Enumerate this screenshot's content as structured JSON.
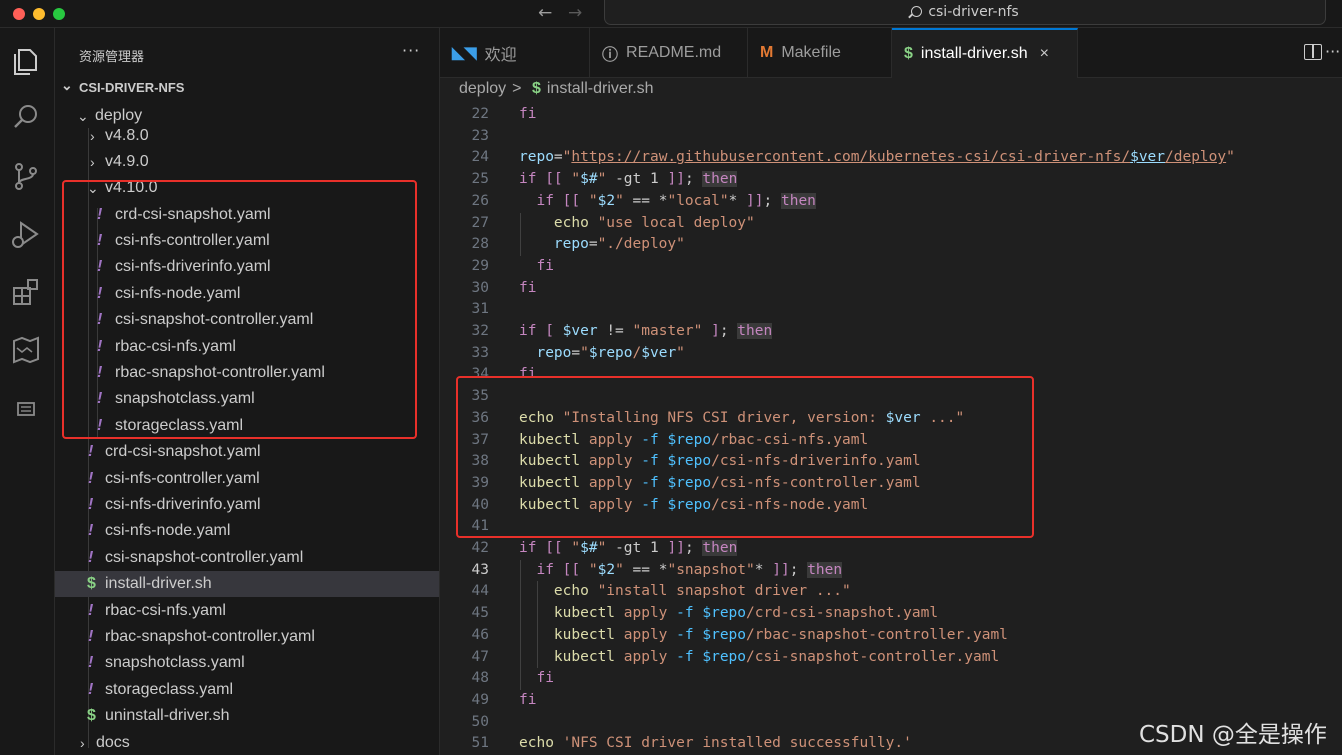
{
  "window": {
    "search_text": "csi-driver-nfs"
  },
  "sidebar": {
    "title": "资源管理器",
    "more": "···",
    "section": "CSI-DRIVER-NFS",
    "tree": [
      {
        "label": "deploy",
        "type": "folder",
        "expanded": true
      },
      {
        "label": "v4.8.0",
        "type": "folder",
        "expanded": false
      },
      {
        "label": "v4.9.0",
        "type": "folder",
        "expanded": false
      },
      {
        "label": "v4.10.0",
        "type": "folder",
        "expanded": true
      },
      {
        "label": "crd-csi-snapshot.yaml",
        "type": "yaml"
      },
      {
        "label": "csi-nfs-controller.yaml",
        "type": "yaml"
      },
      {
        "label": "csi-nfs-driverinfo.yaml",
        "type": "yaml"
      },
      {
        "label": "csi-nfs-node.yaml",
        "type": "yaml"
      },
      {
        "label": "csi-snapshot-controller.yaml",
        "type": "yaml"
      },
      {
        "label": "rbac-csi-nfs.yaml",
        "type": "yaml"
      },
      {
        "label": "rbac-snapshot-controller.yaml",
        "type": "yaml"
      },
      {
        "label": "snapshotclass.yaml",
        "type": "yaml"
      },
      {
        "label": "storageclass.yaml",
        "type": "yaml"
      },
      {
        "label": "crd-csi-snapshot.yaml",
        "type": "yaml"
      },
      {
        "label": "csi-nfs-controller.yaml",
        "type": "yaml"
      },
      {
        "label": "csi-nfs-driverinfo.yaml",
        "type": "yaml"
      },
      {
        "label": "csi-nfs-node.yaml",
        "type": "yaml"
      },
      {
        "label": "csi-snapshot-controller.yaml",
        "type": "yaml"
      },
      {
        "label": "install-driver.sh",
        "type": "sh",
        "active": true
      },
      {
        "label": "rbac-csi-nfs.yaml",
        "type": "yaml"
      },
      {
        "label": "rbac-snapshot-controller.yaml",
        "type": "yaml"
      },
      {
        "label": "snapshotclass.yaml",
        "type": "yaml"
      },
      {
        "label": "storageclass.yaml",
        "type": "yaml"
      },
      {
        "label": "uninstall-driver.sh",
        "type": "sh"
      },
      {
        "label": "docs",
        "type": "folder",
        "expanded": false
      }
    ]
  },
  "tabs": [
    {
      "label": "欢迎",
      "icon": "vscode-icon"
    },
    {
      "label": "README.md",
      "icon": "info-icon"
    },
    {
      "label": "Makefile",
      "icon": "makefile-icon"
    },
    {
      "label": "install-driver.sh",
      "icon": "shell-icon",
      "active": true,
      "close": "×"
    }
  ],
  "breadcrumb": {
    "folder": "deploy",
    "separator": ">",
    "file_icon": "$",
    "file": "install-driver.sh"
  },
  "icons": {
    "yaml": "!",
    "sh": "$",
    "chev_open": "⌄",
    "chev_closed": "›"
  },
  "editor": {
    "current_line": 43,
    "lines": [
      {
        "n": "22",
        "html": "<span class=\"k\">fi</span>"
      },
      {
        "n": "23",
        "html": ""
      },
      {
        "n": "24",
        "html": "<span class=\"v\">repo</span><span class=\"o\">=</span><span class=\"s\">\"</span><span class=\"u\">https://raw.githubusercontent.com/kubernetes-csi/csi-driver-nfs/</span><span class=\"v\" style=\"text-decoration:underline\">$ver</span><span class=\"u\">/deploy</span><span class=\"s\">\"</span>"
      },
      {
        "n": "25",
        "html": "<span class=\"k\">if</span> <span class=\"k\">[[</span> <span class=\"s\">\"</span><span class=\"v\">$#</span><span class=\"s\">\"</span> <span class=\"o\">-gt</span> 1 <span class=\"k\">]]</span>; <span class=\"kw\">then</span>"
      },
      {
        "n": "26",
        "html": "  <span class=\"k\">if</span> <span class=\"k\">[[</span> <span class=\"s\">\"</span><span class=\"v\">$2</span><span class=\"s\">\"</span> == <span class=\"o\">*</span><span class=\"s\">\"local\"</span><span class=\"o\">*</span> <span class=\"k\">]]</span>; <span class=\"kw\">then</span>"
      },
      {
        "n": "27",
        "html": "    <span class=\"f\">echo</span> <span class=\"s\">\"use local deploy\"</span>"
      },
      {
        "n": "28",
        "html": "    <span class=\"v\">repo</span><span class=\"o\">=</span><span class=\"s\">\"./deploy\"</span>"
      },
      {
        "n": "29",
        "html": "  <span class=\"k\">fi</span>"
      },
      {
        "n": "30",
        "html": "<span class=\"k\">fi</span>"
      },
      {
        "n": "31",
        "html": ""
      },
      {
        "n": "32",
        "html": "<span class=\"k\">if</span> <span class=\"k\">[</span> <span class=\"v\">$ver</span> != <span class=\"s\">\"master\"</span> <span class=\"k\">]</span>; <span class=\"kw\">then</span>"
      },
      {
        "n": "33",
        "html": "  <span class=\"v\">repo</span><span class=\"o\">=</span><span class=\"s\">\"</span><span class=\"v\">$repo</span><span class=\"s\">/</span><span class=\"v\">$ver</span><span class=\"s\">\"</span>"
      },
      {
        "n": "34",
        "html": "<span class=\"k\">fi</span>"
      },
      {
        "n": "35",
        "html": ""
      },
      {
        "n": "36",
        "html": "<span class=\"f\">echo</span> <span class=\"s\">\"Installing NFS CSI driver, version: </span><span class=\"v\">$ver</span><span class=\"s\"> ...\"</span>"
      },
      {
        "n": "37",
        "html": "<span class=\"f\">kubectl</span> <span class=\"s\">apply</span> <span class=\"sc\">-f</span> <span class=\"sc\">$repo</span><span class=\"s\">/rbac-csi-nfs.yaml</span>"
      },
      {
        "n": "38",
        "html": "<span class=\"f\">kubectl</span> <span class=\"s\">apply</span> <span class=\"sc\">-f</span> <span class=\"sc\">$repo</span><span class=\"s\">/csi-nfs-driverinfo.yaml</span>"
      },
      {
        "n": "39",
        "html": "<span class=\"f\">kubectl</span> <span class=\"s\">apply</span> <span class=\"sc\">-f</span> <span class=\"sc\">$repo</span><span class=\"s\">/csi-nfs-controller.yaml</span>"
      },
      {
        "n": "40",
        "html": "<span class=\"f\">kubectl</span> <span class=\"s\">apply</span> <span class=\"sc\">-f</span> <span class=\"sc\">$repo</span><span class=\"s\">/csi-nfs-node.yaml</span>"
      },
      {
        "n": "41",
        "html": ""
      },
      {
        "n": "42",
        "html": "<span class=\"k\">if</span> <span class=\"k\">[[</span> <span class=\"s\">\"</span><span class=\"v\">$#</span><span class=\"s\">\"</span> <span class=\"o\">-gt</span> 1 <span class=\"k\">]]</span>; <span class=\"kw\">then</span>"
      },
      {
        "n": "43",
        "html": "  <span class=\"k\">if</span> <span class=\"k\">[[</span> <span class=\"s\">\"</span><span class=\"v\">$2</span><span class=\"s\">\"</span> == <span class=\"o\">*</span><span class=\"s\">\"snapshot\"</span><span class=\"o\">*</span> <span class=\"k\">]]</span>; <span class=\"kw\">then</span>"
      },
      {
        "n": "44",
        "html": "    <span class=\"f\">echo</span> <span class=\"s\">\"install snapshot driver ...\"</span>"
      },
      {
        "n": "45",
        "html": "    <span class=\"f\">kubectl</span> <span class=\"s\">apply</span> <span class=\"sc\">-f</span> <span class=\"sc\">$repo</span><span class=\"s\">/crd-csi-snapshot.yaml</span>"
      },
      {
        "n": "46",
        "html": "    <span class=\"f\">kubectl</span> <span class=\"s\">apply</span> <span class=\"sc\">-f</span> <span class=\"sc\">$repo</span><span class=\"s\">/rbac-snapshot-controller.yaml</span>"
      },
      {
        "n": "47",
        "html": "    <span class=\"f\">kubectl</span> <span class=\"s\">apply</span> <span class=\"sc\">-f</span> <span class=\"sc\">$repo</span><span class=\"s\">/csi-snapshot-controller.yaml</span>"
      },
      {
        "n": "48",
        "html": "  <span class=\"k\">fi</span>"
      },
      {
        "n": "49",
        "html": "<span class=\"k\">fi</span>"
      },
      {
        "n": "50",
        "html": ""
      },
      {
        "n": "51",
        "html": "<span class=\"f\">echo</span> <span class=\"s\">'NFS CSI driver installed successfully.'</span>"
      }
    ]
  },
  "watermark": "CSDN @全是操作",
  "colors": {
    "accent": "#0078d4",
    "annotation": "#e8302a",
    "yaml_icon": "#a074c4",
    "shell_icon": "#89d185"
  }
}
